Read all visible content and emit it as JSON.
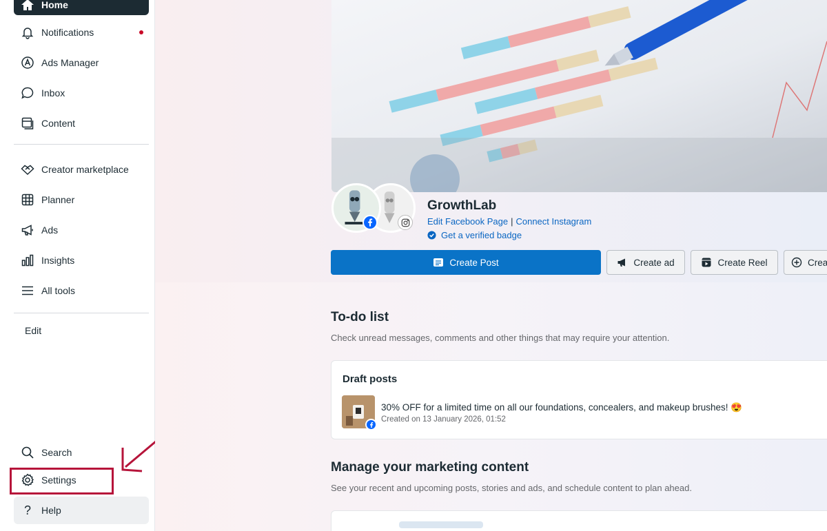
{
  "sidebar": {
    "items": [
      {
        "label": "Home"
      },
      {
        "label": "Notifications"
      },
      {
        "label": "Ads Manager"
      },
      {
        "label": "Inbox"
      },
      {
        "label": "Content"
      },
      {
        "label": "Creator marketplace"
      },
      {
        "label": "Planner"
      },
      {
        "label": "Ads"
      },
      {
        "label": "Insights"
      },
      {
        "label": "All tools"
      }
    ],
    "edit_label": "Edit",
    "bottom_items": [
      {
        "label": "Search"
      },
      {
        "label": "Settings"
      },
      {
        "label": "Help"
      }
    ],
    "notification_dot_color": "#c80a28"
  },
  "profile": {
    "name": "GrowthLab",
    "edit_link": "Edit Facebook Page",
    "separator": "|",
    "connect_link": "Connect Instagram",
    "verified_link": "Get a verified badge"
  },
  "actions": {
    "create_post": "Create Post",
    "create_ad": "Create ad",
    "create_reel": "Create Reel",
    "create_more": "Crea"
  },
  "todo": {
    "title": "To-do list",
    "subtitle": "Check unread messages, comments and other things that may require your attention.",
    "card": {
      "title": "Draft posts",
      "post_text": "30% OFF for a limited time on all our foundations, concealers, and makeup brushes! 😍",
      "post_date": "Created on 13 January 2026, 01:52"
    }
  },
  "marketing": {
    "title": "Manage your marketing content",
    "subtitle": "See your recent and upcoming posts, stories and ads, and schedule content to plan ahead."
  },
  "colors": {
    "primary": "#0a73c7",
    "link": "#0a66c2",
    "highlight": "#b6143a",
    "facebook": "#0866ff"
  }
}
